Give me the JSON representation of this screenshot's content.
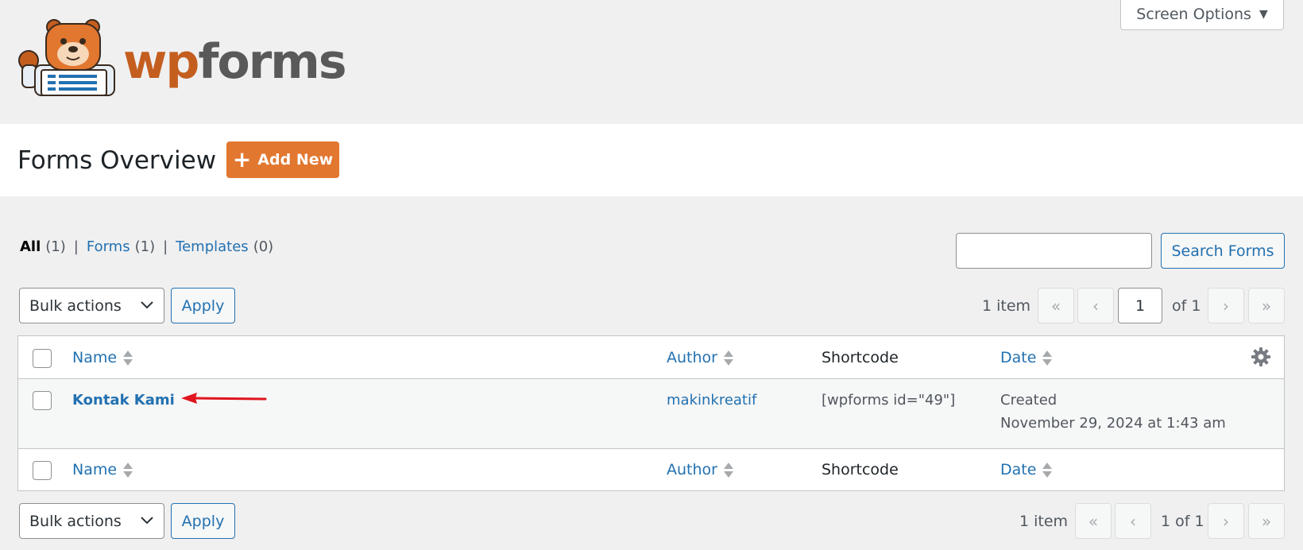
{
  "brand": {
    "wordmark_wp": "wp",
    "wordmark_forms": "forms",
    "accent": "#e27730",
    "link_color": "#2271b1"
  },
  "screen_options": {
    "label": "Screen Options"
  },
  "page": {
    "title": "Forms Overview",
    "add_new_label": "Add New"
  },
  "views": {
    "all": {
      "label": "All",
      "count": "(1)"
    },
    "forms": {
      "label": "Forms",
      "count": "(1)"
    },
    "templates": {
      "label": "Templates",
      "count": "(0)"
    },
    "separator": "|"
  },
  "search": {
    "placeholder": "",
    "button_label": "Search Forms"
  },
  "tablenav_top": {
    "bulk_label": "Bulk actions",
    "apply_label": "Apply",
    "count": "1 item",
    "first": "«",
    "prev": "‹",
    "current_page": "1",
    "of_total": "of 1",
    "next": "›",
    "last": "»"
  },
  "tablenav_bottom": {
    "bulk_label": "Bulk actions",
    "apply_label": "Apply",
    "count": "1 item",
    "first": "«",
    "prev": "‹",
    "page_text": "1 of 1",
    "next": "›",
    "last": "»"
  },
  "table": {
    "columns": {
      "name": "Name",
      "author": "Author",
      "shortcode": "Shortcode",
      "date": "Date"
    },
    "rows": [
      {
        "name": "Kontak Kami",
        "author": "makinkreatif",
        "shortcode": "[wpforms id=\"49\"]",
        "date_status": "Created",
        "date_value": "November 29, 2024 at 1:43 am"
      }
    ]
  },
  "icons": {
    "gear": "gear-icon",
    "mascot": "wpforms-bear-logo",
    "arrow": "red-arrow-annotation"
  }
}
